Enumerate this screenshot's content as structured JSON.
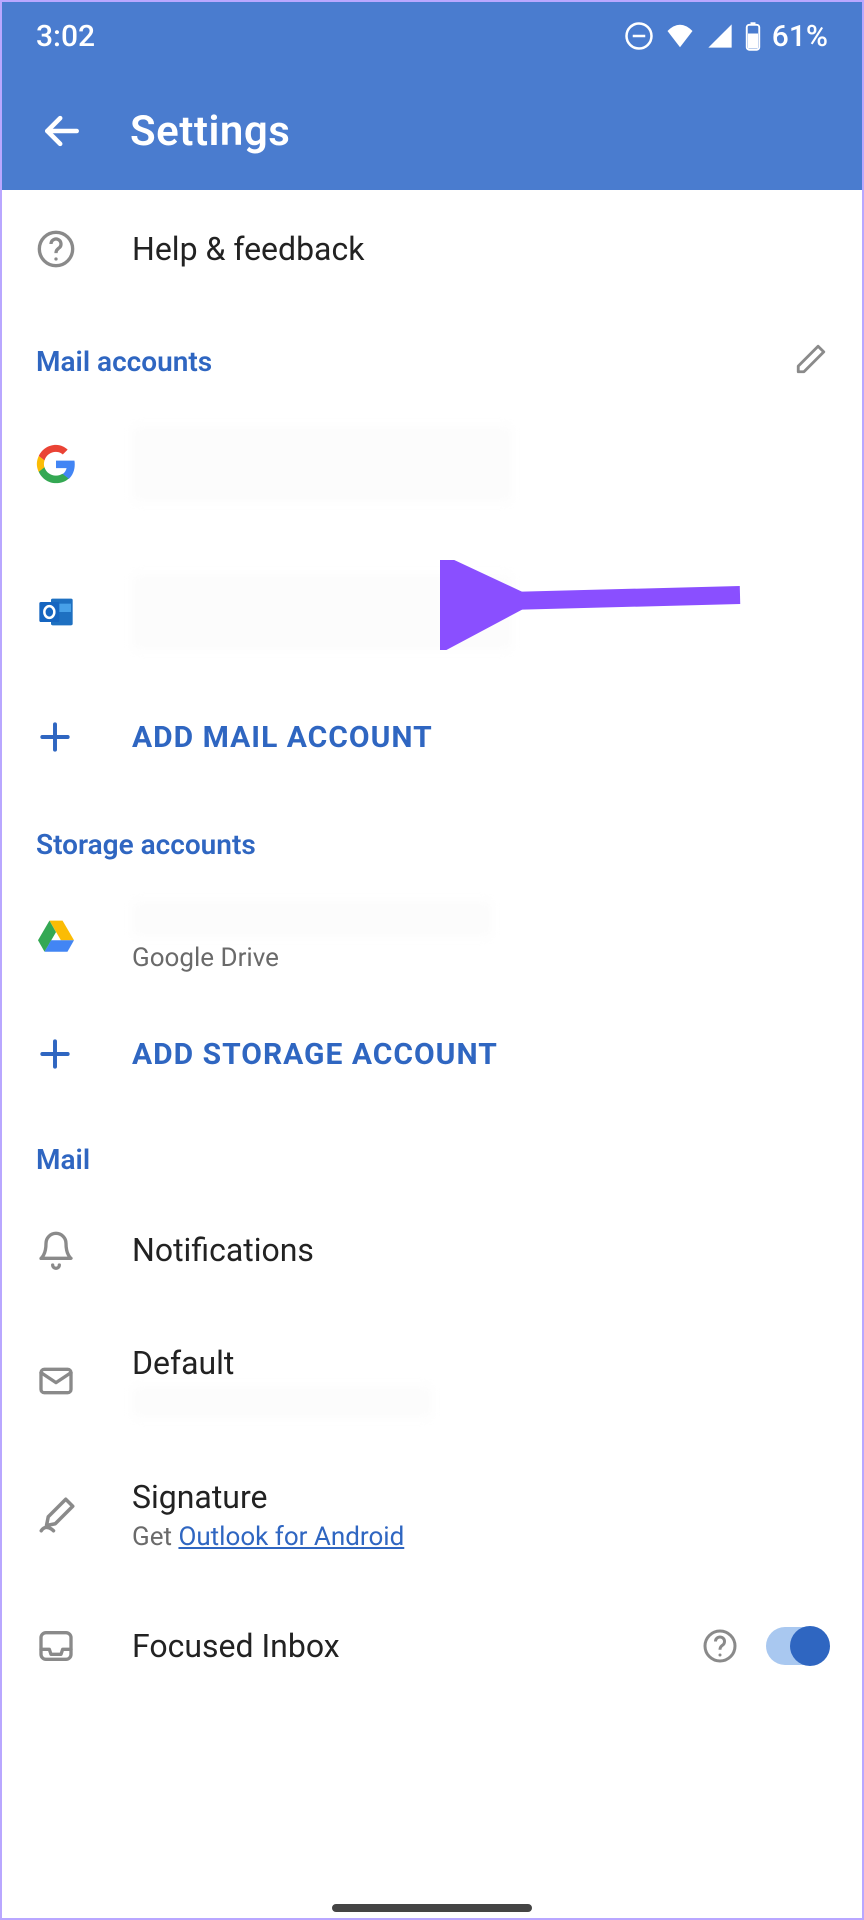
{
  "status_bar": {
    "time": "3:02",
    "battery_text": "61%"
  },
  "app_bar": {
    "title": "Settings"
  },
  "help_feedback": {
    "label": "Help & feedback"
  },
  "sections": {
    "mail_accounts": {
      "title": "Mail accounts",
      "add_label": "ADD MAIL ACCOUNT"
    },
    "storage_accounts": {
      "title": "Storage accounts",
      "drive_sub": "Google Drive",
      "add_label": "ADD STORAGE ACCOUNT"
    },
    "mail": {
      "title": "Mail",
      "notifications": "Notifications",
      "default_label": "Default",
      "signature_label": "Signature",
      "signature_sub_prefix": "Get ",
      "signature_link": "Outlook for Android",
      "focused_inbox": "Focused Inbox"
    }
  }
}
